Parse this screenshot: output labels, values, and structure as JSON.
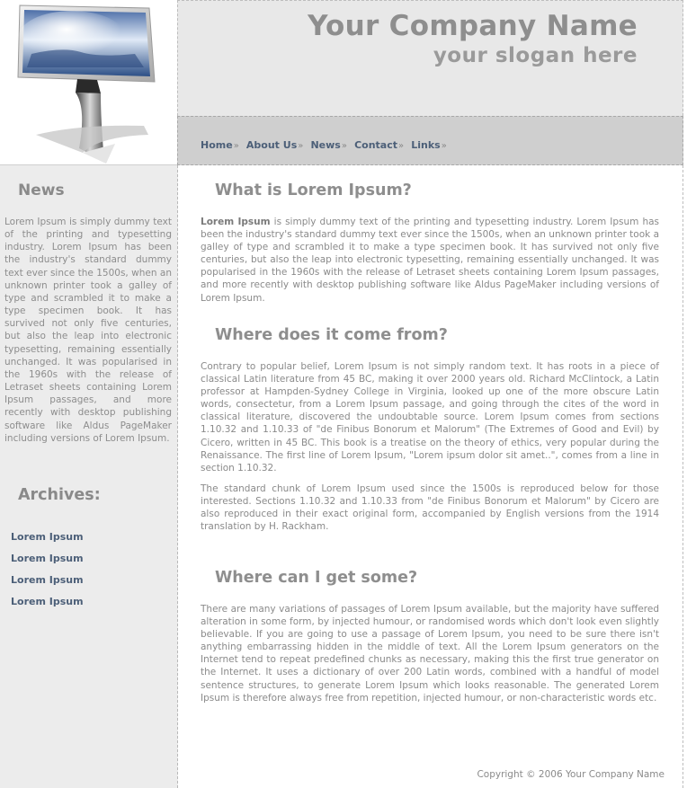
{
  "header": {
    "company_name": "Your Company Name",
    "slogan": "your slogan here"
  },
  "nav": {
    "items": [
      {
        "label": "Home"
      },
      {
        "label": "About Us"
      },
      {
        "label": "News"
      },
      {
        "label": "Contact"
      },
      {
        "label": "Links"
      }
    ],
    "separator": "»"
  },
  "sidebar": {
    "news_title": "News",
    "news_text": "Lorem Ipsum is simply dummy text of the printing and typesetting industry. Lorem Ipsum has been the industry's standard dummy text ever since the 1500s, when an unknown printer took a galley of type and scrambled it to make a type specimen book. It has survived not only five centuries, but also the leap into electronic typesetting, remaining essentially unchanged. It was popularised in the 1960s with the release of Letraset sheets containing Lorem Ipsum passages, and more recently with desktop publishing software like Aldus PageMaker including versions of Lorem Ipsum.",
    "archives_title": "Archives:",
    "archives": [
      {
        "label": "Lorem Ipsum"
      },
      {
        "label": "Lorem Ipsum"
      },
      {
        "label": "Lorem Ipsum"
      },
      {
        "label": "Lorem Ipsum"
      }
    ]
  },
  "main": {
    "section1_title": "What is Lorem Ipsum?",
    "section1_bold": "Lorem Ipsum",
    "section1_text": " is simply dummy text of the printing and typesetting industry. Lorem Ipsum has been the industry's standard dummy text ever since the 1500s, when an unknown printer took a galley of type and scrambled it to make a type specimen book. It has survived not only five centuries, but also the leap into electronic typesetting, remaining essentially unchanged. It was popularised in the 1960s with the release of Letraset sheets containing Lorem Ipsum passages, and more recently with desktop publishing software like Aldus PageMaker including versions of Lorem Ipsum.",
    "section2_title": "Where does it come from?",
    "section2_para1": "Contrary to popular belief, Lorem Ipsum is not simply random text. It has roots in a piece of classical Latin literature from 45 BC, making it over 2000 years old. Richard McClintock, a Latin professor at Hampden-Sydney College in Virginia, looked up one of the more obscure Latin words, consectetur, from a Lorem Ipsum passage, and going through the cites of the word in classical literature, discovered the undoubtable source. Lorem Ipsum comes from sections 1.10.32 and 1.10.33 of \"de Finibus Bonorum et Malorum\" (The Extremes of Good and Evil) by Cicero, written in 45 BC. This book is a treatise on the theory of ethics, very popular during the Renaissance. The first line of Lorem Ipsum, \"Lorem ipsum dolor sit amet..\", comes from a line in section 1.10.32.",
    "section2_para2": "The standard chunk of Lorem Ipsum used since the 1500s is reproduced below for those interested. Sections 1.10.32 and 1.10.33 from \"de Finibus Bonorum et Malorum\" by Cicero are also reproduced in their exact original form, accompanied by English versions from the 1914 translation by H. Rackham.",
    "section3_title": "Where can I get some?",
    "section3_text": "There are many variations of passages of Lorem Ipsum available, but the majority have suffered alteration in some form, by injected humour, or randomised words which don't look even slightly believable. If you are going to use a passage of Lorem Ipsum, you need to be sure there isn't anything embarrassing hidden in the middle of text. All the Lorem Ipsum generators on the Internet tend to repeat predefined chunks as necessary, making this the first true generator on the Internet. It uses a dictionary of over 200 Latin words, combined with a handful of model sentence structures, to generate Lorem Ipsum which looks reasonable. The generated Lorem Ipsum is therefore always free from repetition, injected humour, or non-characteristic words etc."
  },
  "footer": {
    "copyright": "Copyright © 2006 Your Company Name"
  },
  "colors": {
    "header_bg": "#e8e8e8",
    "nav_bg": "#cfcfcf",
    "sidebar_bg": "#ececec",
    "link": "#4c5f78",
    "heading": "#8e8e8e"
  }
}
